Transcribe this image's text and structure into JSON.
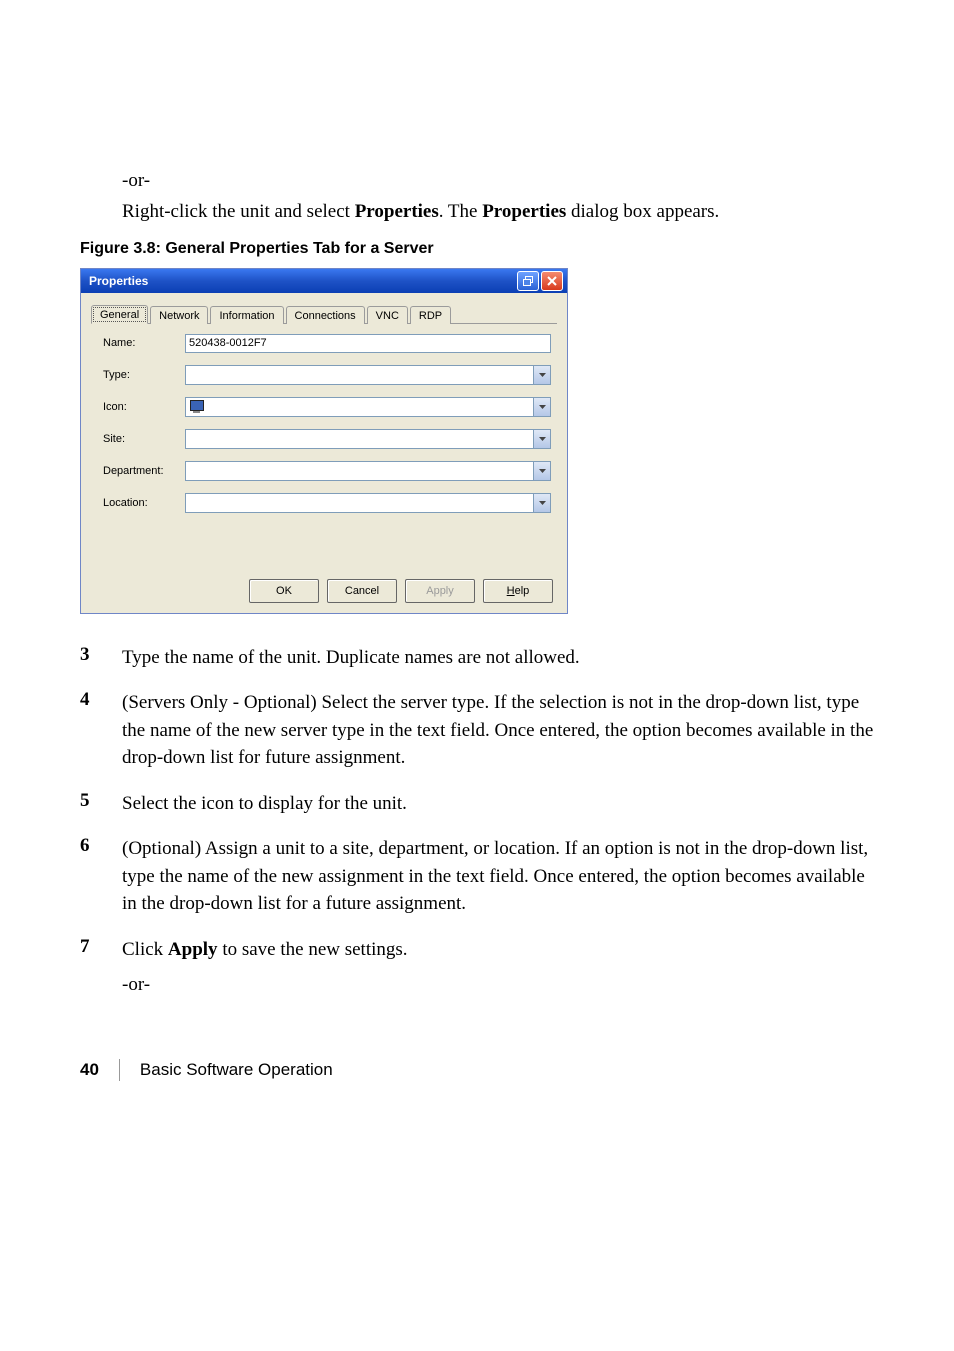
{
  "intro": {
    "or": "-or-",
    "line_a": "Right-click the unit and select ",
    "line_b": "Properties",
    "line_c": ". The ",
    "line_d": "Properties",
    "line_e": " dialog box appears."
  },
  "figcap": "Figure 3.8: General Properties Tab for a Server",
  "dialog": {
    "title": "Properties",
    "tabs": [
      "General",
      "Network",
      "Information",
      "Connections",
      "VNC",
      "RDP"
    ],
    "labels": {
      "name": "Name:",
      "type": "Type:",
      "icon": "Icon:",
      "site": "Site:",
      "department": "Department:",
      "location": "Location:"
    },
    "values": {
      "name": "520438-0012F7",
      "type": "",
      "site": "",
      "department": "",
      "location": ""
    },
    "buttons": {
      "ok": "OK",
      "cancel": "Cancel",
      "apply": "Apply",
      "help_pre": "H",
      "help_rest": "elp"
    }
  },
  "steps": {
    "s3": {
      "num": "3",
      "text": "Type the name of the unit. Duplicate names are not allowed."
    },
    "s4": {
      "num": "4",
      "text": "(Servers Only - Optional) Select the server type. If the selection is not in the drop-down list, type the name of the new server type in the text field. Once entered, the option becomes available in the drop-down list for future assignment."
    },
    "s5": {
      "num": "5",
      "text": "Select the icon to display for the unit."
    },
    "s6": {
      "num": "6",
      "text": "(Optional) Assign a unit to a site, department, or location. If an option is not in the drop-down list, type the name of the new assignment in the text field. Once entered, the option becomes available in the drop-down list for a future assignment."
    },
    "s7": {
      "num": "7",
      "text_a": "Click ",
      "text_bold": "Apply",
      "text_b": " to save the new settings.",
      "or": "-or-"
    }
  },
  "footer": {
    "page": "40",
    "section": "Basic Software Operation"
  }
}
